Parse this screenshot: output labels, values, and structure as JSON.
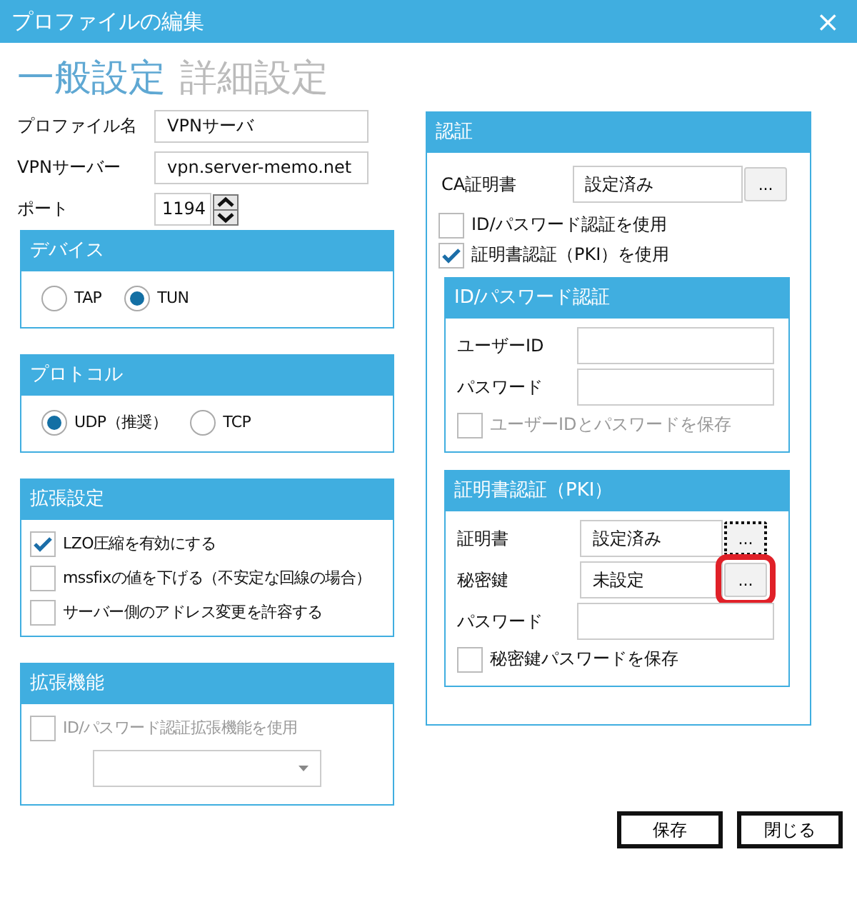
{
  "window": {
    "title": "プロファイルの編集",
    "close": "×"
  },
  "tabs": [
    {
      "label": "一般設定",
      "selected": true
    },
    {
      "label": "詳細設定",
      "selected": false
    }
  ],
  "fields": [
    {
      "label": "プロファイル名",
      "value": "VPNサーバ"
    },
    {
      "label": "VPNサーバー",
      "value": "vpn.server-memo.net"
    }
  ],
  "port": {
    "label": "ポート",
    "value": "1194"
  },
  "groups": [
    {
      "title": "デバイス",
      "items": [
        {
          "kind": "radio",
          "label": "TAP",
          "selected": false
        },
        {
          "kind": "radio",
          "label": "TUN",
          "selected": true
        }
      ]
    },
    {
      "title": "プロトコル",
      "items": [
        {
          "kind": "radio",
          "label": "UDP（推奨）",
          "selected": true
        },
        {
          "kind": "radio",
          "label": "TCP",
          "selected": false
        }
      ]
    },
    {
      "title": "拡張設定",
      "items": [
        {
          "kind": "checkbox",
          "label": "LZO圧縮を有効にする",
          "checked": true,
          "disabled": false
        },
        {
          "kind": "checkbox",
          "label": "mssfixの値を下げる（不安定な回線の場合）",
          "checked": false,
          "disabled": false
        },
        {
          "kind": "checkbox",
          "label": "サーバー側のアドレス変更を許容する",
          "checked": false,
          "disabled": false
        }
      ]
    },
    {
      "title": "拡張機能",
      "items": [
        {
          "kind": "checkbox",
          "label": "ID/パスワード認証拡張機能を使用",
          "checked": false,
          "disabled": true
        },
        {
          "kind": "dropdown",
          "disabled": true
        }
      ]
    }
  ],
  "auth": {
    "title": "認証",
    "ca": {
      "label": "CA証明書",
      "value": "設定済み",
      "button": "..."
    },
    "checks": [
      {
        "label": "ID/パスワード認証を使用",
        "checked": false
      },
      {
        "label": "証明書認証（PKI）を使用",
        "checked": true
      }
    ],
    "panels": [
      {
        "title": "ID/パスワード認証",
        "rows": [
          {
            "kind": "field",
            "label": "ユーザーID"
          },
          {
            "kind": "field",
            "label": "パスワード"
          },
          {
            "kind": "checkbox",
            "label": "ユーザーIDとパスワードを保存",
            "checked": false,
            "disabled": true
          }
        ]
      },
      {
        "title": "証明書認証（PKI）",
        "rows": [
          {
            "kind": "file",
            "label": "証明書",
            "value": "設定済み",
            "button": "...",
            "focused": true,
            "highlighted": false
          },
          {
            "kind": "file",
            "label": "秘密鍵",
            "value": "未設定",
            "button": "...",
            "focused": false,
            "highlighted": true
          },
          {
            "kind": "field",
            "label": "パスワード"
          },
          {
            "kind": "checkbox",
            "label": "秘密鍵パスワードを保存",
            "checked": false,
            "disabled": false
          }
        ]
      }
    ]
  },
  "buttons": [
    "保存",
    "閉じる"
  ]
}
